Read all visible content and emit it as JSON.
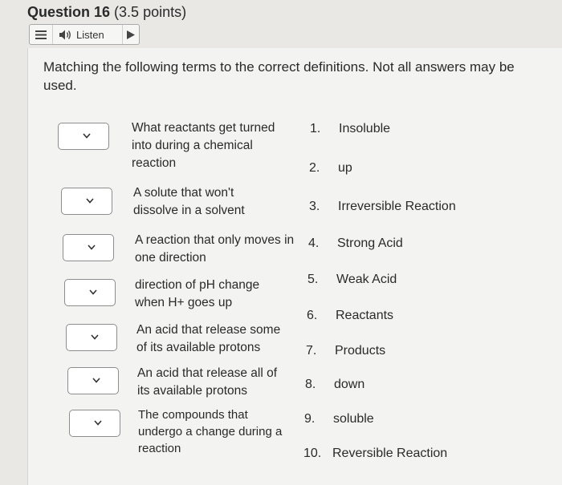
{
  "question": {
    "label": "Question 16",
    "points": "(3.5 points)"
  },
  "listen_bar": {
    "listen_label": "Listen",
    "icons": [
      "menu-icon",
      "speaker-icon",
      "play-icon"
    ]
  },
  "instructions": "Matching the following terms to the correct definitions. Not all answers may be used.",
  "terms": [
    {
      "text": "What reactants get turned into during a chemical reaction",
      "selected": ""
    },
    {
      "text": "A solute that won't dissolve in a solvent",
      "selected": ""
    },
    {
      "text": "A reaction that only moves in one direction",
      "selected": ""
    },
    {
      "text": "direction of pH change when H+ goes up",
      "selected": ""
    },
    {
      "text": "An acid that release some of its available protons",
      "selected": ""
    },
    {
      "text": "An acid that release all of its available protons",
      "selected": ""
    },
    {
      "text": "The compounds that undergo a change during a reaction",
      "selected": ""
    }
  ],
  "answers": [
    {
      "num": "1.",
      "text": "Insoluble"
    },
    {
      "num": "2.",
      "text": "up"
    },
    {
      "num": "3.",
      "text": "Irreversible Reaction"
    },
    {
      "num": "4.",
      "text": "Strong Acid"
    },
    {
      "num": "5.",
      "text": "Weak Acid"
    },
    {
      "num": "6.",
      "text": "Reactants"
    },
    {
      "num": "7.",
      "text": "Products"
    },
    {
      "num": "8.",
      "text": "down"
    },
    {
      "num": "9.",
      "text": "soluble"
    },
    {
      "num": "10.",
      "text": "Reversible Reaction"
    }
  ]
}
